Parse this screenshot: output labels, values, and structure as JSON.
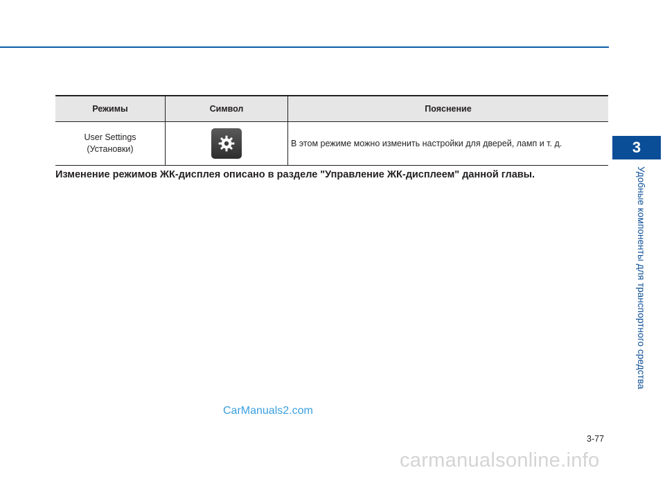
{
  "chapter": {
    "number": "3",
    "title": "Удобные компоненты для транспортного средства"
  },
  "table": {
    "headers": [
      "Режимы",
      "Символ",
      "Пояснение"
    ],
    "rows": [
      {
        "mode_line1": "User Settings",
        "mode_line2": "(Установки)",
        "icon": "gear-icon",
        "description": "В этом режиме можно изменить настройки для дверей, ламп и т. д."
      }
    ]
  },
  "note": "Изменение режимов ЖК-дисплея описано в разделе \"Управление ЖК-дисплеем\" данной главы.",
  "watermark": "CarManuals2.com",
  "page_number": "3-77",
  "footer_watermark": "carmanualsonline.info",
  "colors": {
    "accent": "#0b4e98",
    "rule": "#0b5ca8",
    "header_bg": "#e6e6e6",
    "watermark": "#3aa0e0"
  }
}
